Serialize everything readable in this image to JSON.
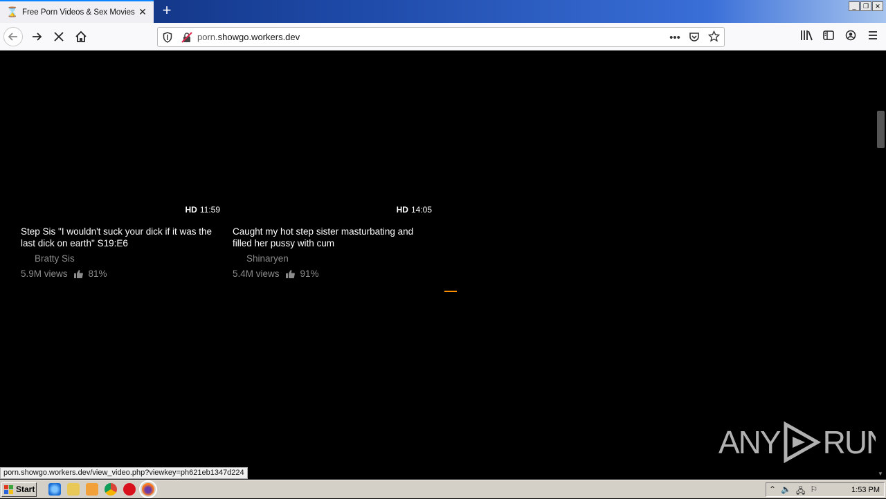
{
  "browser": {
    "tab_title": "Free Porn Videos & Sex Movies - P",
    "new_tab": "+",
    "url_domain_prefix": "porn.",
    "url_domain_main": "showgo.workers.dev",
    "url_more": "•••",
    "status_link": "porn.showgo.workers.dev/view_video.php?viewkey=ph621eb1347d224"
  },
  "videos": [
    {
      "hd": "HD",
      "duration": "11:59",
      "title": "Step Sis \"I wouldn't suck your dick if it was the last dick on earth\" S19:E6",
      "uploader": "Bratty Sis",
      "views": "5.9M views",
      "rating": "81%"
    },
    {
      "hd": "HD",
      "duration": "14:05",
      "title": "Caught my hot step sister masturbating and filled her pussy with cum",
      "uploader": "Shinaryen",
      "views": "5.4M views",
      "rating": "91%"
    }
  ],
  "watermark": {
    "left": "ANY",
    "right": "RUN"
  },
  "taskbar": {
    "start_label": "Start",
    "clock": "1:53 PM"
  },
  "colors": {
    "accent": "#ff9000",
    "tab_highlight": "#0a84ff",
    "meta_text": "#8b8b8b"
  }
}
